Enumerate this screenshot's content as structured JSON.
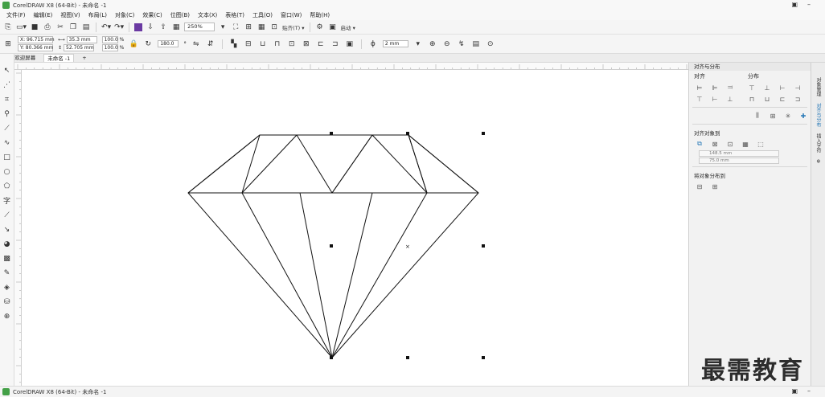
{
  "window": {
    "title": "CorelDRAW X8 (64-Bit) - 未命名 -1",
    "restore_glyph": "▣",
    "minimize_glyph": "–"
  },
  "menu": [
    "文件(F)",
    "编辑(E)",
    "视图(V)",
    "布局(L)",
    "对象(C)",
    "效果(C)",
    "位图(B)",
    "文本(X)",
    "表格(T)",
    "工具(O)",
    "窗口(W)",
    "帮助(H)"
  ],
  "standard_toolbar": {
    "zoom": "250%",
    "snap_label": "贴齐(T) ▾",
    "launch_label": "启动 ▾"
  },
  "property_bar": {
    "x": "X: 96.715 mm",
    "y": "Y: 80.366 mm",
    "width": "35.3 mm",
    "height": "52.705 mm",
    "scale_x": "100.0",
    "scale_y": "100.0",
    "percent": "%",
    "rotation": "180.0",
    "degree": "°",
    "outline": "2 mm"
  },
  "tabs": {
    "welcome": "欢迎屏幕",
    "doc": "未命名 -1",
    "add": "+"
  },
  "docker": {
    "title": "对齐与分布",
    "align_label": "对齐",
    "distribute_label": "分布",
    "align_to_label": "对齐对象到",
    "x_field": "148.5 mm",
    "y_field": "75.0 mm",
    "distribute_to_label": "将对象分布到"
  },
  "side_tabs": [
    "对象管理",
    "对齐与分布",
    "插入字符"
  ],
  "watermark": "最需教育",
  "taskbar": {
    "title": "CorelDRAW X8 (64-Bit) - 未命名 -1"
  },
  "colors": {
    "accent": "#2a7ab8",
    "app_icon": "#43a047"
  }
}
